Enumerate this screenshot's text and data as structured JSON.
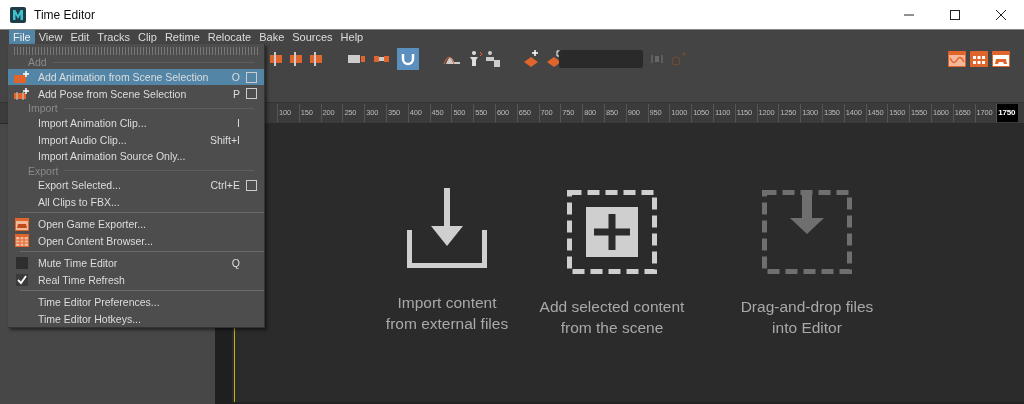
{
  "window": {
    "title": "Time Editor"
  },
  "menubar": [
    {
      "label": "File",
      "selected": true
    },
    {
      "label": "View",
      "selected": false
    },
    {
      "label": "Edit",
      "selected": false
    },
    {
      "label": "Tracks",
      "selected": false
    },
    {
      "label": "Clip",
      "selected": false
    },
    {
      "label": "Retime",
      "selected": false
    },
    {
      "label": "Relocate",
      "selected": false
    },
    {
      "label": "Bake",
      "selected": false
    },
    {
      "label": "Sources",
      "selected": false
    },
    {
      "label": "Help",
      "selected": false
    }
  ],
  "file_menu": [
    {
      "kind": "section",
      "label": "Add"
    },
    {
      "kind": "item",
      "label": "Add Animation from Scene Selection",
      "shortcut": "O",
      "option_box": true,
      "selected": true
    },
    {
      "kind": "item",
      "label": "Add Pose from Scene Selection",
      "shortcut": "P",
      "option_box": true,
      "selected": false
    },
    {
      "kind": "section",
      "label": "Import"
    },
    {
      "kind": "item",
      "label": "Import Animation Clip...",
      "shortcut": "I",
      "option_box": false,
      "selected": false
    },
    {
      "kind": "item",
      "label": "Import Audio Clip...",
      "shortcut": "Shift+I",
      "option_box": false,
      "selected": false
    },
    {
      "kind": "item",
      "label": "Import Animation Source Only...",
      "option_box": false,
      "selected": false
    },
    {
      "kind": "section",
      "label": "Export"
    },
    {
      "kind": "item",
      "label": "Export Selected...",
      "shortcut": "Ctrl+E",
      "option_box": true,
      "selected": false
    },
    {
      "kind": "item",
      "label": "All Clips to FBX...",
      "option_box": false,
      "selected": false
    },
    {
      "kind": "separator"
    },
    {
      "kind": "item",
      "label": "Open Game Exporter...",
      "option_box": false,
      "selected": false
    },
    {
      "kind": "item",
      "label": "Open Content Browser...",
      "option_box": false,
      "selected": false
    },
    {
      "kind": "separator"
    },
    {
      "kind": "check",
      "label": "Mute Time Editor",
      "shortcut": "Q",
      "checked": false,
      "selected": false
    },
    {
      "kind": "check",
      "label": "Real Time Refresh",
      "checked": true,
      "selected": false
    },
    {
      "kind": "separator"
    },
    {
      "kind": "item",
      "label": "Time Editor Preferences...",
      "option_box": false,
      "selected": false
    },
    {
      "kind": "item",
      "label": "Time Editor Hotkeys...",
      "option_box": false,
      "selected": false
    }
  ],
  "ruler": [
    {
      "label": "100",
      "selected": false
    },
    {
      "label": "150",
      "selected": false
    },
    {
      "label": "200",
      "selected": false
    },
    {
      "label": "250",
      "selected": false
    },
    {
      "label": "300",
      "selected": false
    },
    {
      "label": "350",
      "selected": false
    },
    {
      "label": "400",
      "selected": false
    },
    {
      "label": "450",
      "selected": false
    },
    {
      "label": "500",
      "selected": false
    },
    {
      "label": "550",
      "selected": false
    },
    {
      "label": "600",
      "selected": false
    },
    {
      "label": "650",
      "selected": false
    },
    {
      "label": "700",
      "selected": false
    },
    {
      "label": "750",
      "selected": false
    },
    {
      "label": "800",
      "selected": false
    },
    {
      "label": "850",
      "selected": false
    },
    {
      "label": "900",
      "selected": false
    },
    {
      "label": "950",
      "selected": false
    },
    {
      "label": "1000",
      "selected": false
    },
    {
      "label": "1050",
      "selected": false
    },
    {
      "label": "1100",
      "selected": false
    },
    {
      "label": "1150",
      "selected": false
    },
    {
      "label": "1200",
      "selected": false
    },
    {
      "label": "1250",
      "selected": false
    },
    {
      "label": "1300",
      "selected": false
    },
    {
      "label": "1350",
      "selected": false
    },
    {
      "label": "1400",
      "selected": false
    },
    {
      "label": "1450",
      "selected": false
    },
    {
      "label": "1500",
      "selected": false
    },
    {
      "label": "1550",
      "selected": false
    },
    {
      "label": "1600",
      "selected": false
    },
    {
      "label": "1650",
      "selected": false
    },
    {
      "label": "1700",
      "selected": false
    },
    {
      "label": "1750",
      "selected": true
    }
  ],
  "empty_state": [
    {
      "kind": "import",
      "lines": [
        "Import content",
        "from external files"
      ]
    },
    {
      "kind": "add",
      "lines": [
        "Add selected content",
        "from the scene"
      ]
    },
    {
      "kind": "drop",
      "lines": [
        "Drag-and-drop files",
        "into Editor"
      ]
    }
  ]
}
